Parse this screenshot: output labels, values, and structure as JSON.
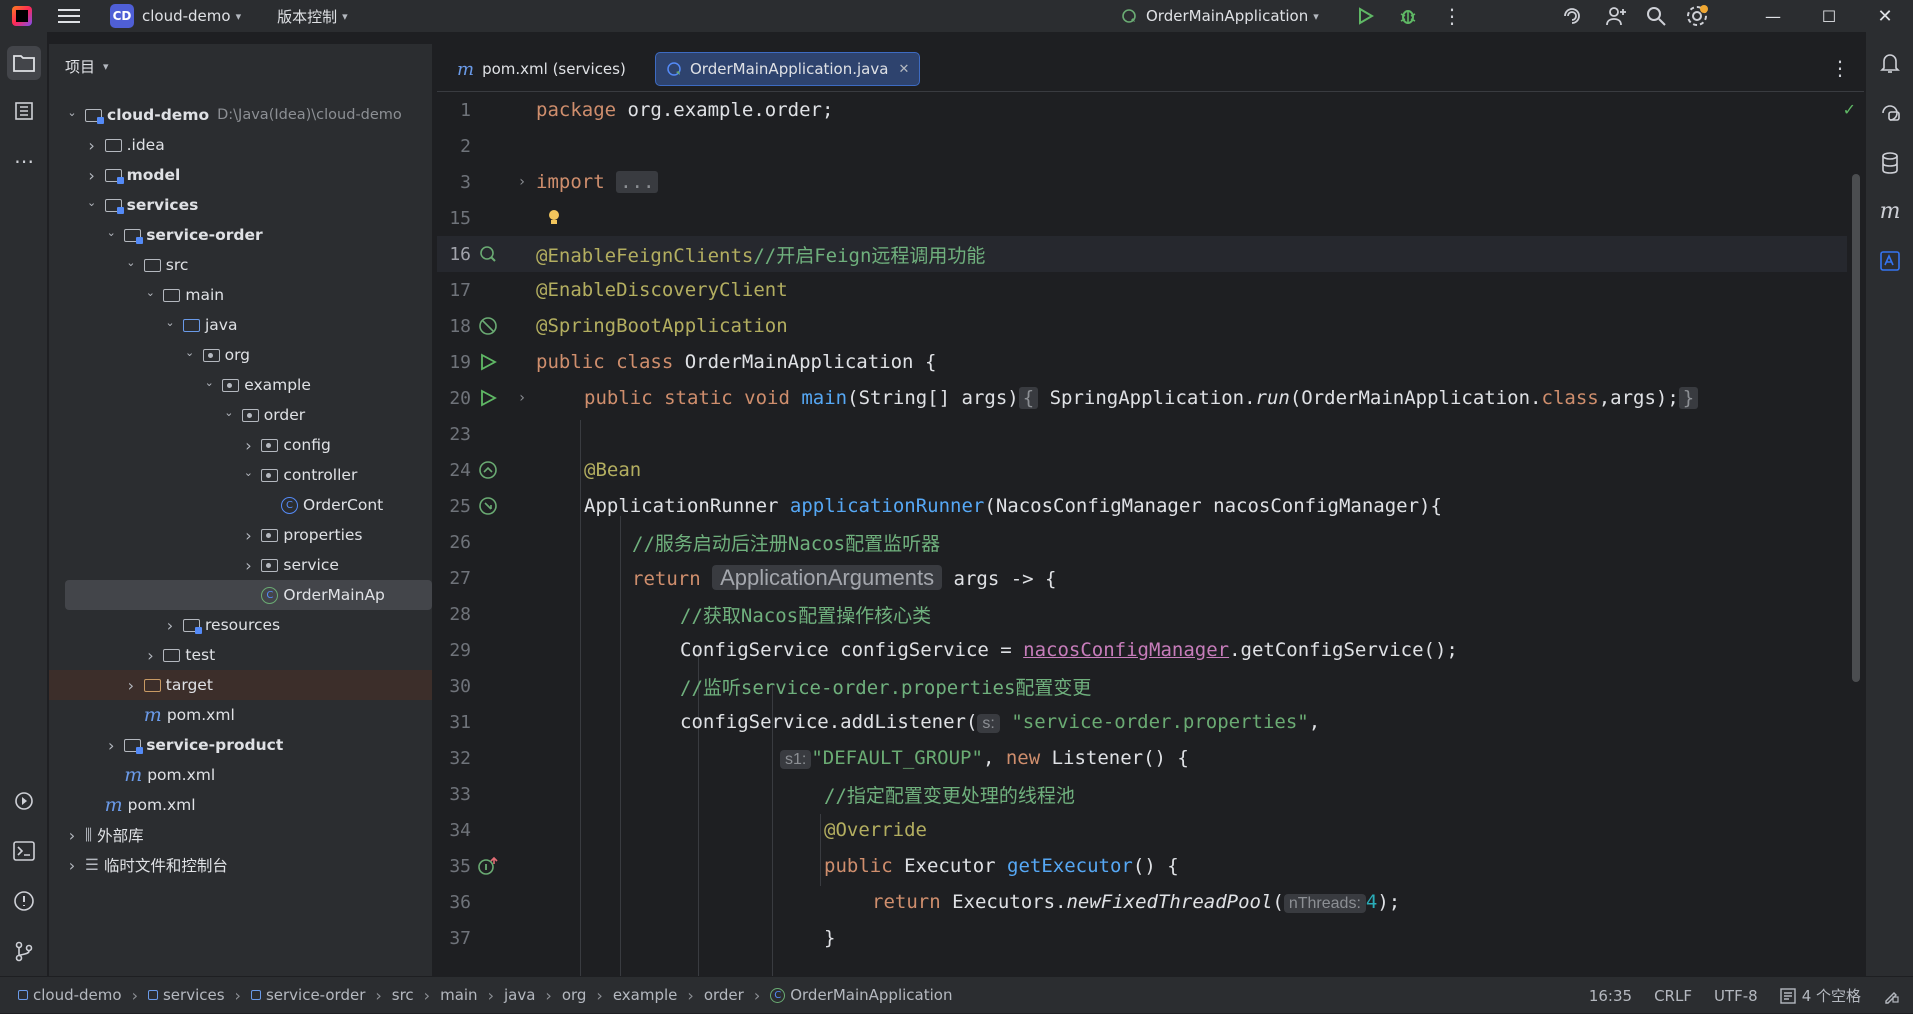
{
  "titlebar": {
    "project_badge": "CD",
    "project_name": "cloud-demo",
    "vcs_label": "版本控制",
    "run_config": "OrderMainApplication"
  },
  "project_panel": {
    "title": "项目",
    "tree": [
      {
        "label": "cloud-demo",
        "extra": "D:\\Java(Idea)\\cloud-demo",
        "depth": 0,
        "arrow": "open",
        "icon": "folder-module",
        "bold": true
      },
      {
        "label": ".idea",
        "depth": 1,
        "arrow": "closed",
        "icon": "folder"
      },
      {
        "label": "model",
        "depth": 1,
        "arrow": "closed",
        "icon": "folder-module",
        "bold": true
      },
      {
        "label": "services",
        "depth": 1,
        "arrow": "open",
        "icon": "folder-module",
        "bold": true
      },
      {
        "label": "service-order",
        "depth": 2,
        "arrow": "open",
        "icon": "folder-module",
        "bold": true
      },
      {
        "label": "src",
        "depth": 3,
        "arrow": "open",
        "icon": "folder"
      },
      {
        "label": "main",
        "depth": 4,
        "arrow": "open",
        "icon": "folder"
      },
      {
        "label": "java",
        "depth": 5,
        "arrow": "open",
        "icon": "folder-blue"
      },
      {
        "label": "org",
        "depth": 6,
        "arrow": "open",
        "icon": "package"
      },
      {
        "label": "example",
        "depth": 7,
        "arrow": "open",
        "icon": "package"
      },
      {
        "label": "order",
        "depth": 8,
        "arrow": "open",
        "icon": "package"
      },
      {
        "label": "config",
        "depth": 9,
        "arrow": "closed",
        "icon": "package"
      },
      {
        "label": "controller",
        "depth": 9,
        "arrow": "open",
        "icon": "package"
      },
      {
        "label": "OrderCont",
        "depth": 10,
        "arrow": "none",
        "icon": "class"
      },
      {
        "label": "properties",
        "depth": 9,
        "arrow": "closed",
        "icon": "package"
      },
      {
        "label": "service",
        "depth": 9,
        "arrow": "closed",
        "icon": "package"
      },
      {
        "label": "OrderMainAp",
        "depth": 9,
        "arrow": "none",
        "icon": "class-app",
        "selected": true
      },
      {
        "label": "resources",
        "depth": 5,
        "arrow": "closed",
        "icon": "folder-res"
      },
      {
        "label": "test",
        "depth": 4,
        "arrow": "closed",
        "icon": "folder"
      },
      {
        "label": "target",
        "depth": 3,
        "arrow": "closed",
        "icon": "folder-target",
        "highlight": true
      },
      {
        "label": "pom.xml",
        "depth": 3,
        "arrow": "none",
        "icon": "maven"
      },
      {
        "label": "service-product",
        "depth": 2,
        "arrow": "closed",
        "icon": "folder-module",
        "bold": true
      },
      {
        "label": "pom.xml",
        "depth": 2,
        "arrow": "none",
        "icon": "maven"
      },
      {
        "label": "pom.xml",
        "depth": 1,
        "arrow": "none",
        "icon": "maven"
      },
      {
        "label": "外部库",
        "depth": 0,
        "arrow": "closed",
        "icon": "libs"
      },
      {
        "label": "临时文件和控制台",
        "depth": 0,
        "arrow": "closed",
        "icon": "scratch"
      }
    ]
  },
  "tabs": [
    {
      "label": "pom.xml (services)",
      "icon": "maven",
      "active": false
    },
    {
      "label": "OrderMainApplication.java",
      "icon": "class-app",
      "active": true
    }
  ],
  "code": {
    "lines": [
      {
        "n": "1",
        "text": "package org.example.order;"
      },
      {
        "n": "2",
        "text": ""
      },
      {
        "n": "3",
        "text": "import ..."
      },
      {
        "n": "15",
        "text": ""
      },
      {
        "n": "16",
        "text": "@EnableFeignClients//开启Feign远程调用功能"
      },
      {
        "n": "17",
        "text": "@EnableDiscoveryClient"
      },
      {
        "n": "18",
        "text": "@SpringBootApplication"
      },
      {
        "n": "19",
        "text": "public class OrderMainApplication {"
      },
      {
        "n": "20",
        "text": "public static void main(String[] args) { SpringApplication.run(OrderMainApplication.class,args); }"
      },
      {
        "n": "23",
        "text": ""
      },
      {
        "n": "24",
        "text": "@Bean"
      },
      {
        "n": "25",
        "text": "ApplicationRunner applicationRunner(NacosConfigManager nacosConfigManager){"
      },
      {
        "n": "26",
        "text": "//服务启动后注册Nacos配置监听器"
      },
      {
        "n": "27",
        "text": "return ApplicationArguments args -> {"
      },
      {
        "n": "28",
        "text": "//获取Nacos配置操作核心类"
      },
      {
        "n": "29",
        "text": "ConfigService configService = nacosConfigManager.getConfigService();"
      },
      {
        "n": "30",
        "text": "//监听service-order.properties配置变更"
      },
      {
        "n": "31",
        "text": "configService.addListener( s: \"service-order.properties\","
      },
      {
        "n": "32",
        "text": "s1: \"DEFAULT_GROUP\", new Listener() {"
      },
      {
        "n": "33",
        "text": "//指定配置变更处理的线程池"
      },
      {
        "n": "34",
        "text": "@Override"
      },
      {
        "n": "35",
        "text": "public Executor getExecutor() {"
      },
      {
        "n": "36",
        "text": "return Executors.newFixedThreadPool( nThreads: 4);"
      },
      {
        "n": "37",
        "text": "}"
      }
    ]
  },
  "statusbar": {
    "breadcrumbs": [
      "cloud-demo",
      "services",
      "service-order",
      "src",
      "main",
      "java",
      "org",
      "example",
      "order",
      "OrderMainApplication"
    ],
    "position": "16:35",
    "line_sep": "CRLF",
    "encoding": "UTF-8",
    "indent": "4 个空格"
  },
  "colors": {
    "accent": "#3574f0",
    "keyword": "#cf8e6d",
    "annotation": "#b3ae60",
    "function": "#56a8f5",
    "comment": "#6fb07d",
    "string": "#6aab73"
  }
}
